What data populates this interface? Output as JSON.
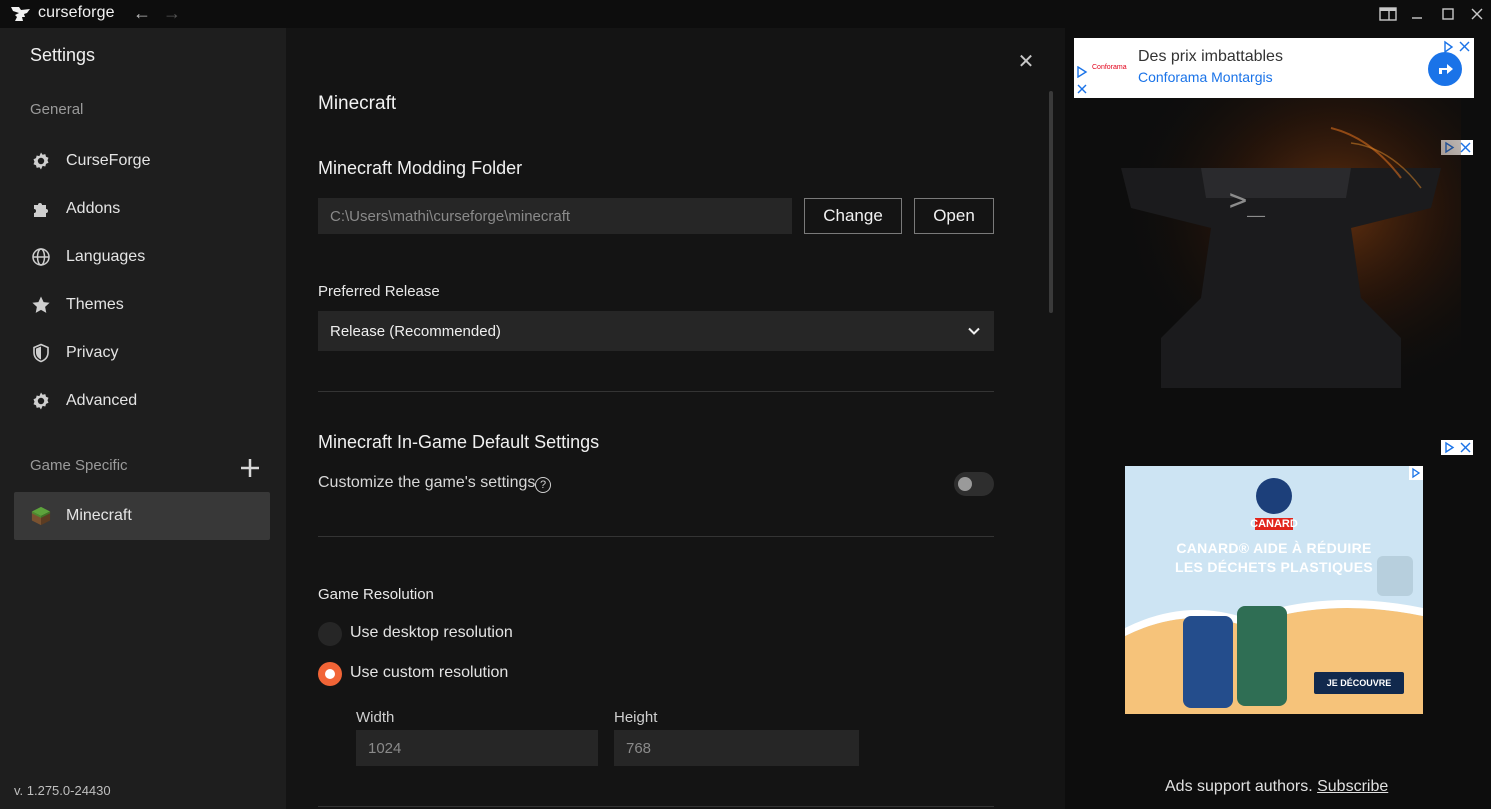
{
  "titlebar": {
    "app_name": "curseforge"
  },
  "sidebar": {
    "title": "Settings",
    "general_label": "General",
    "items": [
      {
        "label": "CurseForge",
        "icon": "gear-icon"
      },
      {
        "label": "Addons",
        "icon": "puzzle-icon"
      },
      {
        "label": "Languages",
        "icon": "globe-icon"
      },
      {
        "label": "Themes",
        "icon": "star-icon"
      },
      {
        "label": "Privacy",
        "icon": "shield-icon"
      },
      {
        "label": "Advanced",
        "icon": "gear-icon"
      }
    ],
    "game_specific_label": "Game Specific",
    "games": [
      {
        "label": "Minecraft",
        "icon": "minecraft-grass-block-icon",
        "active": true
      }
    ],
    "version": "v. 1.275.0-24430"
  },
  "main": {
    "title": "Minecraft",
    "modding_folder": {
      "heading": "Minecraft Modding Folder",
      "path": "C:\\Users\\mathi\\curseforge\\minecraft",
      "change_label": "Change",
      "open_label": "Open"
    },
    "preferred_release": {
      "label": "Preferred Release",
      "value": "Release (Recommended)"
    },
    "ingame_defaults": {
      "heading": "Minecraft In-Game Default Settings",
      "customize_label": "Customize the game's settings",
      "customize_enabled": false
    },
    "resolution": {
      "label": "Game Resolution",
      "option_desktop": "Use desktop resolution",
      "option_custom": "Use custom resolution",
      "selected": "custom",
      "width_label": "Width",
      "width_value": "1024",
      "height_label": "Height",
      "height_value": "768"
    }
  },
  "ads": {
    "banner": {
      "brand": "Conforama",
      "line1": "Des prix imbattables",
      "line2": "Conforama Montargis"
    },
    "canard": {
      "logo": "CANARD",
      "headline1": "CANARD® AIDE À RÉDUIRE",
      "headline2": "LES DÉCHETS PLASTIQUES",
      "cta": "JE DÉCOUVRE"
    },
    "support_text": "Ads support authors.",
    "subscribe_label": "Subscribe"
  },
  "colors": {
    "accent": "#f16436",
    "sidebar_bg": "#1e1e1e",
    "main_bg": "#141414"
  }
}
